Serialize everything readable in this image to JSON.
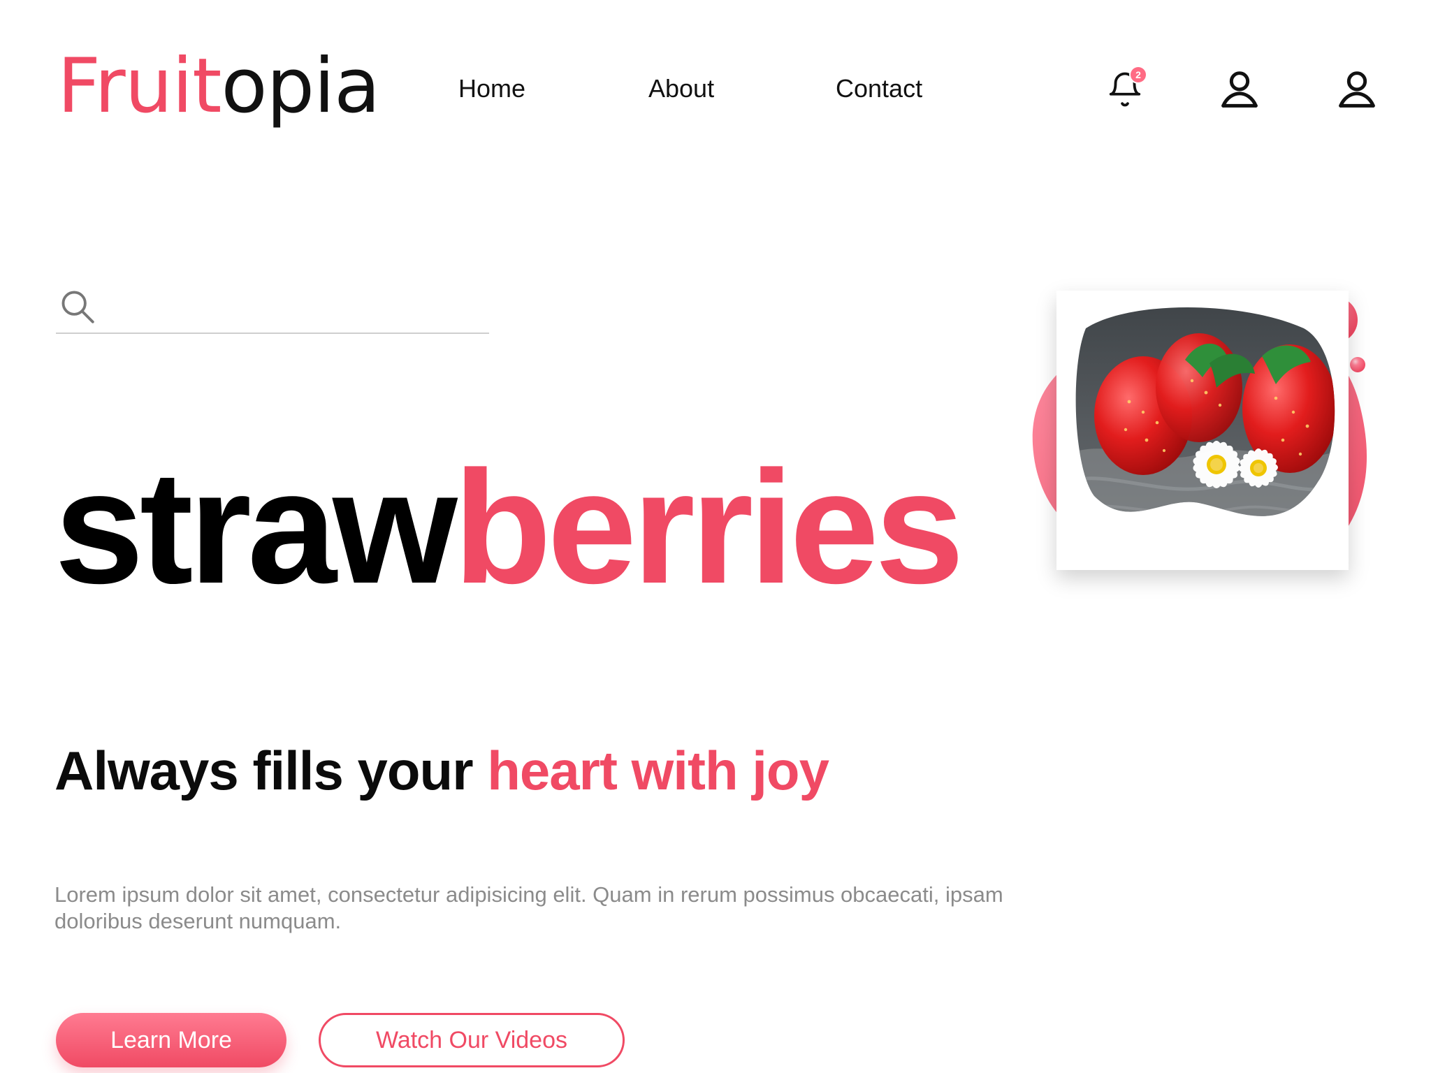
{
  "brand": {
    "part1": "Fruit",
    "part2": "opia",
    "accent_color": "#f04a64"
  },
  "nav": {
    "items": [
      {
        "label": "Home"
      },
      {
        "label": "About"
      },
      {
        "label": "Contact"
      }
    ]
  },
  "header_actions": {
    "notifications_count": "2",
    "icons": [
      "bell-icon",
      "user-icon",
      "user-icon"
    ]
  },
  "search": {
    "placeholder": ""
  },
  "hero": {
    "title_dark": "straw",
    "title_accent": "berries",
    "tagline_dark": "Always fills your ",
    "tagline_accent": "heart with joy",
    "body": "Lorem ipsum dolor sit amet, consectetur adipisicing elit. Quam in rerum possimus obcaecati, ipsam doloribus deserunt numquam."
  },
  "buttons": {
    "primary": "Learn More",
    "secondary": "Watch Our Videos"
  },
  "image": {
    "subject": "strawberries-with-daisies-photo"
  }
}
